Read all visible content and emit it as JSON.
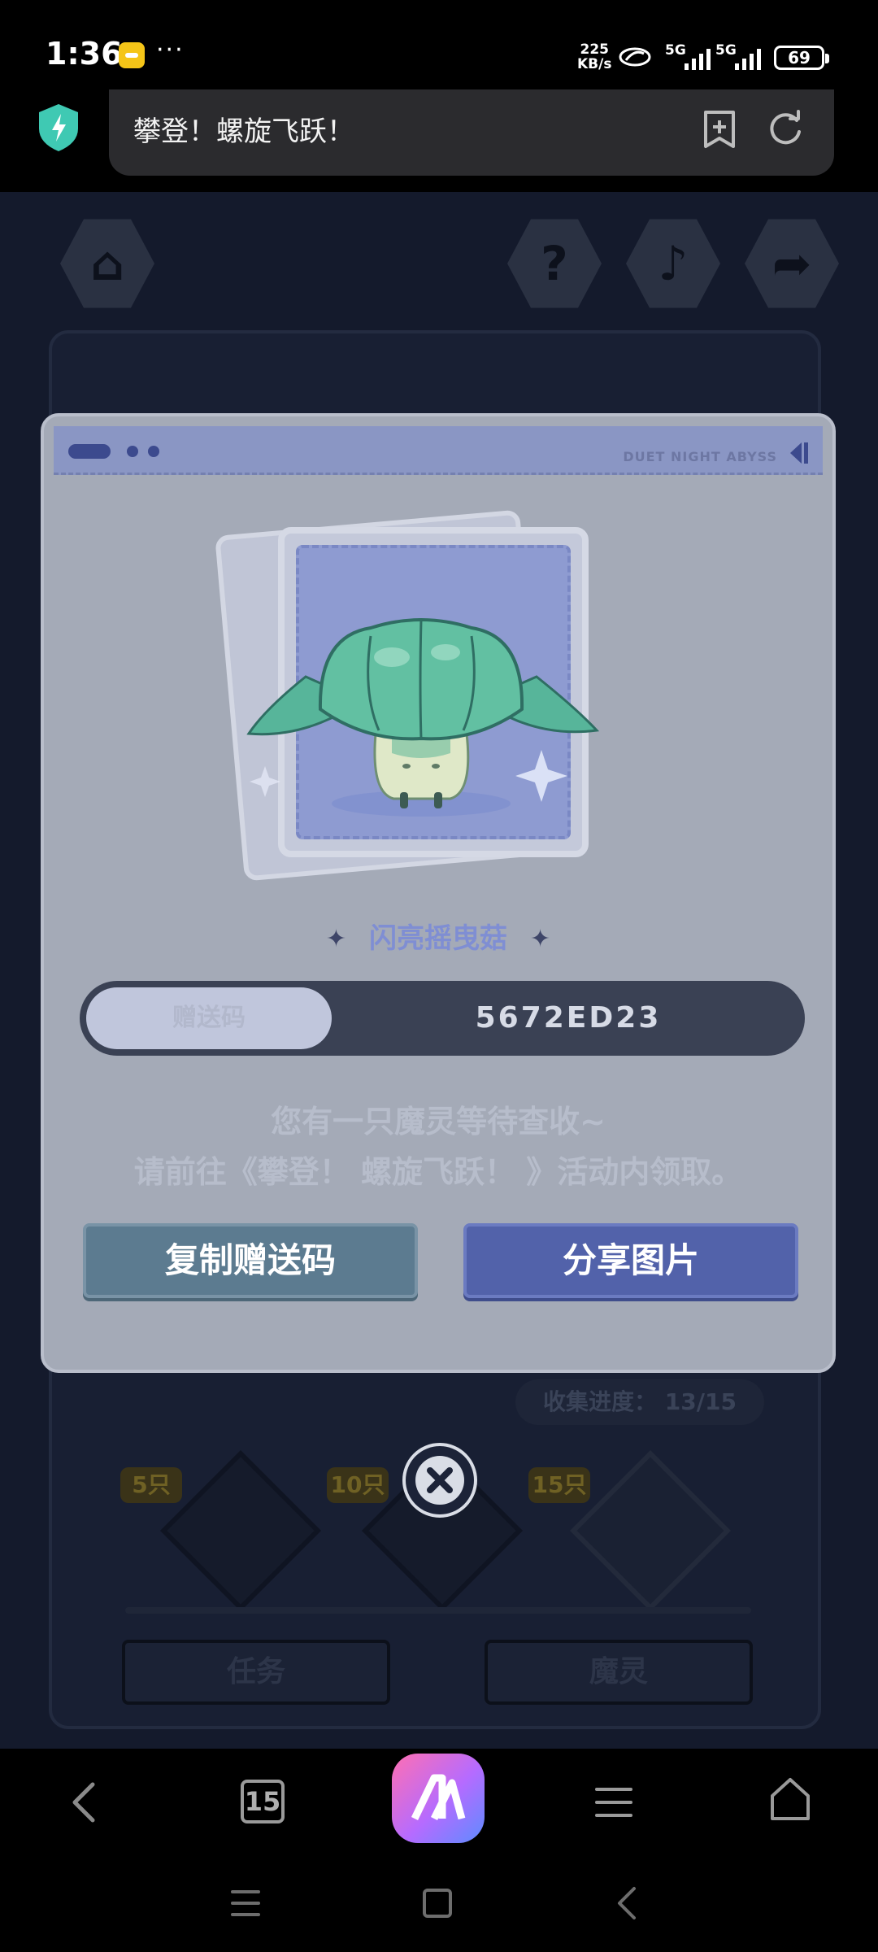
{
  "status_bar": {
    "time": "1:36",
    "more": "···",
    "net_speed_value": "225",
    "net_speed_unit": "KB/s",
    "sim1_label": "5G",
    "sim2_label": "5G",
    "battery": "69"
  },
  "browser": {
    "page_title": "攀登！螺旋飞跃！"
  },
  "background": {
    "collect_progress": "收集进度： 13/15",
    "reward_tags": [
      "5只",
      "10只",
      "15只"
    ],
    "tab_task": "任务",
    "tab_pet": "魔灵"
  },
  "modal": {
    "brand": "DUET NIGHT ABYSS",
    "pet_name": "闪亮摇曳菇",
    "code_label": "赠送码",
    "gift_code": "5672ED23",
    "message_line1": "您有一只魔灵等待查收~",
    "message_line2": "请前往《攀登！ 螺旋飞跃！ 》活动内领取。",
    "copy_button": "复制赠送码",
    "share_button": "分享图片"
  },
  "bottom_nav": {
    "tab_count": "15"
  },
  "colors": {
    "modal_bg": "#a4aab7",
    "modal_header": "#8a96c4",
    "copy_button": "#5c7b90",
    "share_button": "#5262aa",
    "code_bar": "#3a4154",
    "pet_name": "#7f8ed3"
  },
  "icons": {
    "browser_shield": "shield-bolt-icon",
    "bookmark": "bookmark-add-icon",
    "refresh": "refresh-icon",
    "close": "close-x-icon",
    "nav_back": "chevron-left-icon",
    "nav_home": "home-icon",
    "nav_menu": "menu-icon"
  }
}
